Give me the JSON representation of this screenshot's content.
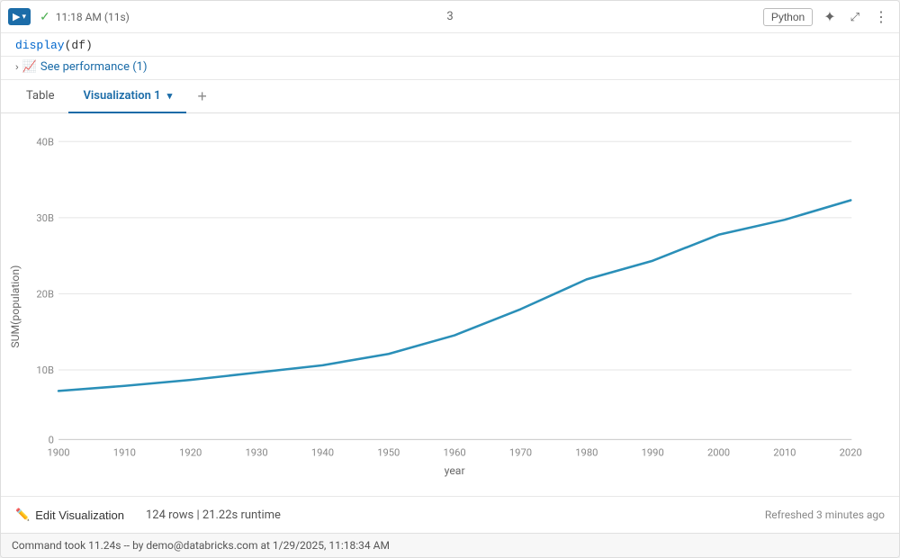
{
  "toolbar": {
    "run_button_label": "▶",
    "dropdown_arrow": "▾",
    "checkmark": "✓",
    "timestamp": "11:18 AM (11s)",
    "cell_number": "3",
    "lang_badge": "Python",
    "magic_icon": "✦",
    "expand_icon": "⤢",
    "more_icon": "⋮"
  },
  "code": {
    "line": "display(df)"
  },
  "performance": {
    "expand_arrow": "›",
    "chart_icon": "📊",
    "label": "See performance (1)"
  },
  "tabs": [
    {
      "id": "table",
      "label": "Table",
      "active": false
    },
    {
      "id": "viz1",
      "label": "Visualization 1",
      "active": true,
      "has_dropdown": true
    }
  ],
  "tab_add_label": "+",
  "chart": {
    "y_axis_label": "SUM(population)",
    "x_axis_label": "year",
    "y_ticks": [
      "40B",
      "30B",
      "20B",
      "10B",
      "0"
    ],
    "x_ticks": [
      "1900",
      "1910",
      "1920",
      "1930",
      "1940",
      "1950",
      "1960",
      "1970",
      "1980",
      "1990",
      "2000",
      "2010",
      "2020"
    ],
    "line_color": "#2a8fb8",
    "data_points": [
      {
        "year": 1900,
        "value": 6.5
      },
      {
        "year": 1910,
        "value": 7.2
      },
      {
        "year": 1920,
        "value": 8.0
      },
      {
        "year": 1930,
        "value": 9.0
      },
      {
        "year": 1940,
        "value": 10.0
      },
      {
        "year": 1950,
        "value": 11.5
      },
      {
        "year": 1960,
        "value": 14.0
      },
      {
        "year": 1970,
        "value": 17.5
      },
      {
        "year": 1980,
        "value": 21.5
      },
      {
        "year": 1990,
        "value": 24.0
      },
      {
        "year": 2000,
        "value": 27.5
      },
      {
        "year": 2010,
        "value": 29.5
      },
      {
        "year": 2020,
        "value": 32.0
      }
    ]
  },
  "footer": {
    "edit_viz_label": "Edit Visualization",
    "stats": "124 rows  |  21.22s runtime",
    "refresh": "Refreshed 3 minutes ago"
  },
  "status_bar": {
    "text": "Command took 11.24s -- by demo@databricks.com at 1/29/2025, 11:18:34 AM"
  }
}
